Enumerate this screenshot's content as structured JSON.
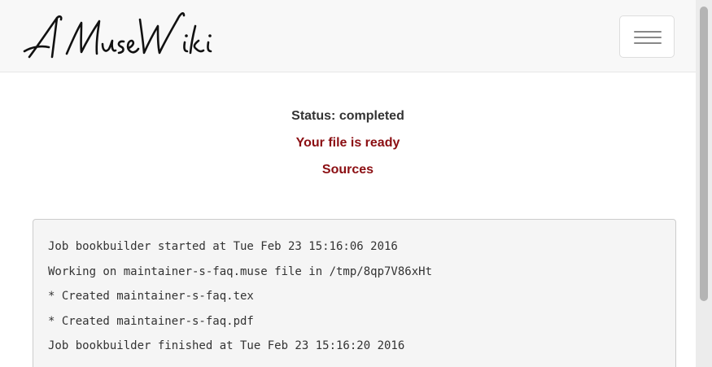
{
  "header": {
    "logo_text": "A MuseWiki",
    "menu_icon": "hamburger-menu-icon"
  },
  "status": {
    "status_text": "Status: completed",
    "ready_link": "Your file is ready",
    "sources_link": "Sources",
    "link_color": "#8b0e12"
  },
  "log": {
    "lines": [
      "Job bookbuilder started at Tue Feb 23 15:16:06 2016",
      "Working on maintainer-s-faq.muse file in /tmp/8qp7V86xHt",
      "* Created maintainer-s-faq.tex",
      "* Created maintainer-s-faq.pdf",
      "Job bookbuilder finished at Tue Feb 23 15:16:20 2016"
    ]
  }
}
